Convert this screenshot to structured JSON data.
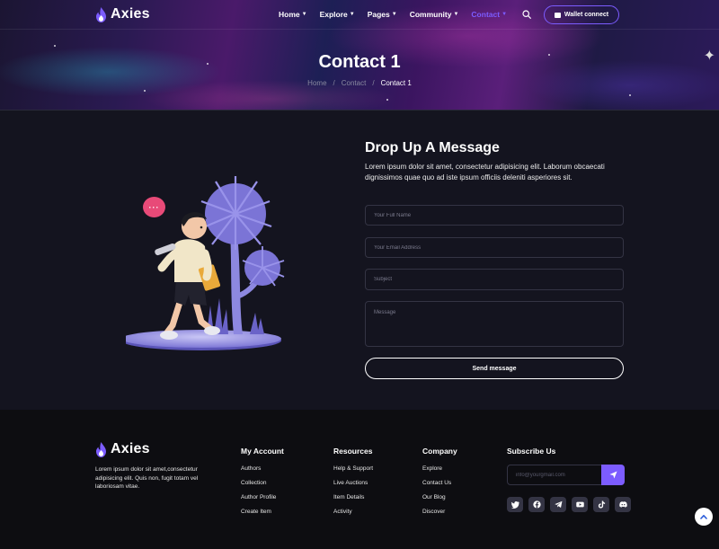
{
  "brand": {
    "name": "Axies",
    "accent": "#7c5cff"
  },
  "nav": {
    "items": [
      {
        "label": "Home",
        "active": false
      },
      {
        "label": "Explore",
        "active": false
      },
      {
        "label": "Pages",
        "active": false
      },
      {
        "label": "Community",
        "active": false
      },
      {
        "label": "Contact",
        "active": true
      }
    ],
    "search_icon": "search-icon",
    "wallet_label": "Wallet connect"
  },
  "hero": {
    "title": "Contact 1",
    "breadcrumb": [
      "Home",
      "Contact",
      "Contact 1"
    ],
    "separator": "/"
  },
  "contact": {
    "heading": "Drop Up A Message",
    "description": "Lorem ipsum dolor sit amet, consectetur adipisicing elit. Laborum obcaecati dignissimos quae quo ad iste ipsum officiis deleniti asperiores sit.",
    "placeholders": {
      "name": "Your Full Name",
      "email": "Your Email Address",
      "subject": "Subject",
      "message": "Message"
    },
    "submit_label": "Send message",
    "chat_bubble": "···"
  },
  "footer": {
    "brand": "Axies",
    "description": "Lorem ipsum dolor sit amet,consectetur adipisicing elit. Quis non, fugit totam vel laboriosam vitae.",
    "columns": [
      {
        "title": "My Account",
        "links": [
          "Authors",
          "Collection",
          "Author Profile",
          "Create Item"
        ]
      },
      {
        "title": "Resources",
        "links": [
          "Help & Support",
          "Live Auctions",
          "Item Details",
          "Activity"
        ]
      },
      {
        "title": "Company",
        "links": [
          "Explore",
          "Contact Us",
          "Our Blog",
          "Discover"
        ]
      }
    ],
    "subscribe": {
      "title": "Subscribe Us",
      "placeholder": "info@yourgmail.com"
    },
    "socials": [
      "twitter-icon",
      "facebook-icon",
      "telegram-icon",
      "youtube-icon",
      "tiktok-icon",
      "discord-icon"
    ]
  }
}
